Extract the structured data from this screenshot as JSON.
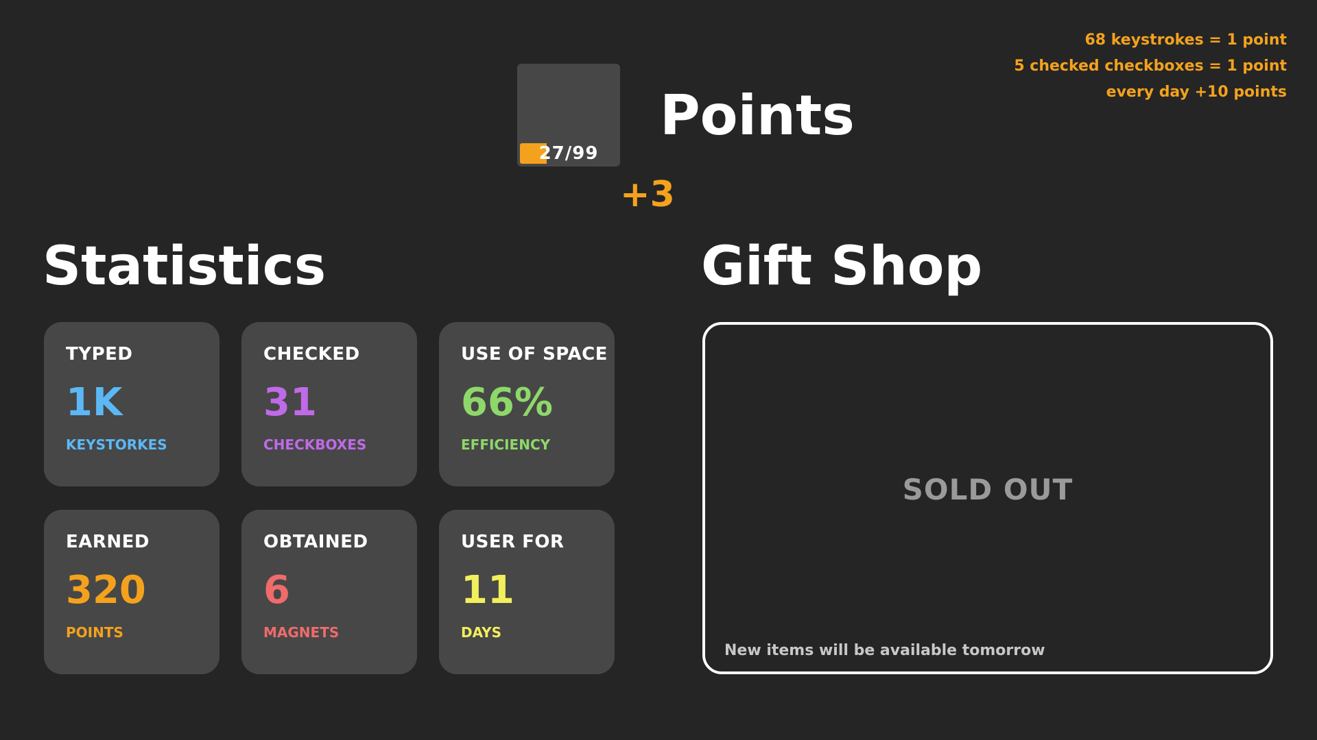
{
  "rules": [
    "68 keystrokes = 1 point",
    "5 checked checkboxes = 1 point",
    "every day +10 points"
  ],
  "points": {
    "title": "Points",
    "progress_text": "27/99",
    "progress_fraction": 0.2727,
    "delta": "+3",
    "accent_color": "#f4a21d"
  },
  "statistics": {
    "title": "Statistics",
    "cards": [
      {
        "label": "TYPED",
        "value": "1K",
        "unit": "KEYSTORKES",
        "color": "#5cb8f5"
      },
      {
        "label": "CHECKED",
        "value": "31",
        "unit": "CHECKBOXES",
        "color": "#c06ae8"
      },
      {
        "label": "USE OF SPACE",
        "value": "66%",
        "unit": "EFFICIENCY",
        "color": "#8ed86a"
      },
      {
        "label": "EARNED",
        "value": "320",
        "unit": "POINTS",
        "color": "#f4a21d"
      },
      {
        "label": "OBTAINED",
        "value": "6",
        "unit": "MAGNETS",
        "color": "#f06b6b"
      },
      {
        "label": "USER FOR",
        "value": "11",
        "unit": "DAYS",
        "color": "#f2ef5c"
      }
    ]
  },
  "gift_shop": {
    "title": "Gift Shop",
    "status": "SOLD OUT",
    "note": "New items will be available tomorrow"
  }
}
